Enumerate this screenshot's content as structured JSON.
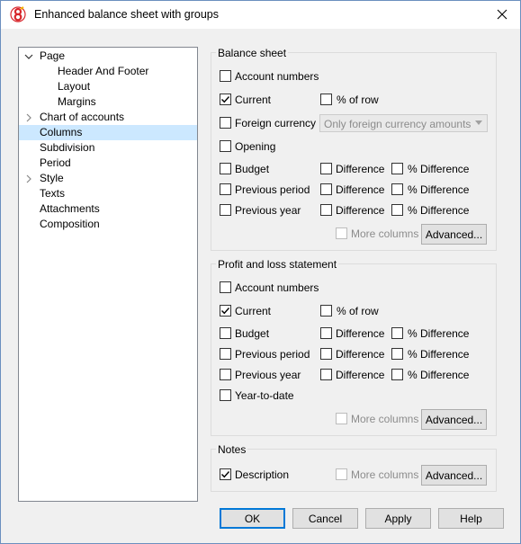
{
  "window": {
    "title": "Enhanced balance sheet with groups",
    "accent_color": "#0078d7",
    "icon": "banana-app-icon"
  },
  "tree": {
    "items": [
      {
        "label": "Page",
        "expanded": true
      },
      {
        "label": "Header And Footer"
      },
      {
        "label": "Layout"
      },
      {
        "label": "Margins"
      },
      {
        "label": "Chart of accounts",
        "expanded": false
      },
      {
        "label": "Columns",
        "selected": true
      },
      {
        "label": "Subdivision"
      },
      {
        "label": "Period"
      },
      {
        "label": "Style",
        "expanded": false
      },
      {
        "label": "Texts"
      },
      {
        "label": "Attachments"
      },
      {
        "label": "Composition"
      }
    ]
  },
  "balance_sheet": {
    "title": "Balance sheet",
    "account_numbers": {
      "label": "Account numbers",
      "checked": false
    },
    "current": {
      "label": "Current",
      "checked": true
    },
    "pct_of_row": {
      "label": "% of row",
      "checked": false
    },
    "foreign_currency": {
      "label": "Foreign currency",
      "checked": false
    },
    "foreign_currency_select": "Only foreign currency amounts",
    "opening": {
      "label": "Opening",
      "checked": false
    },
    "budget": {
      "label": "Budget",
      "checked": false
    },
    "previous_period": {
      "label": "Previous period",
      "checked": false
    },
    "previous_year": {
      "label": "Previous year",
      "checked": false
    },
    "difference_label": "Difference",
    "pct_difference_label": "% Difference",
    "more_columns": {
      "label": "More columns",
      "checked": false
    },
    "advanced_label": "Advanced..."
  },
  "profit_loss": {
    "title": "Profit and loss statement",
    "account_numbers": {
      "label": "Account numbers",
      "checked": false
    },
    "current": {
      "label": "Current",
      "checked": true
    },
    "pct_of_row": {
      "label": "% of row",
      "checked": false
    },
    "budget": {
      "label": "Budget",
      "checked": false
    },
    "previous_period": {
      "label": "Previous period",
      "checked": false
    },
    "previous_year": {
      "label": "Previous year",
      "checked": false
    },
    "year_to_date": {
      "label": "Year-to-date",
      "checked": false
    },
    "difference_label": "Difference",
    "pct_difference_label": "% Difference",
    "more_columns": {
      "label": "More columns",
      "checked": false
    },
    "advanced_label": "Advanced..."
  },
  "notes": {
    "title": "Notes",
    "description": {
      "label": "Description",
      "checked": true
    },
    "more_columns": {
      "label": "More columns",
      "checked": false
    },
    "advanced_label": "Advanced..."
  },
  "footer": {
    "ok_label": "OK",
    "cancel_label": "Cancel",
    "apply_label": "Apply",
    "help_label": "Help"
  }
}
